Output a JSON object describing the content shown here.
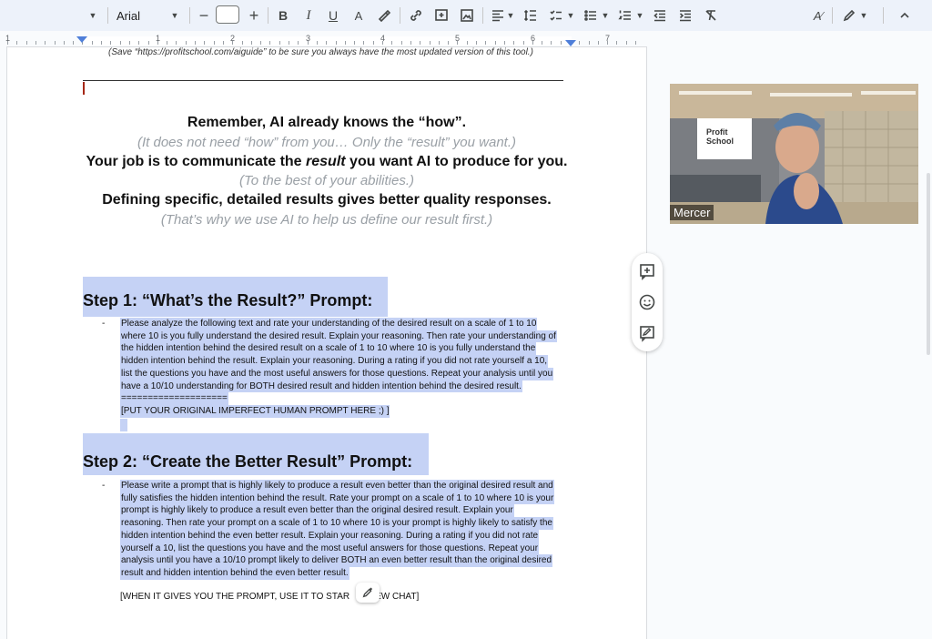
{
  "toolbar": {
    "font_name": "Arial",
    "font_size": "",
    "icons": [
      "undo-caret-icon",
      "bold-icon",
      "italic-icon",
      "underline-icon",
      "text-color-icon",
      "highlight-icon",
      "link-icon",
      "comment-icon",
      "image-icon",
      "align-icon",
      "line-spacing-icon",
      "checklist-icon",
      "bullet-list-icon",
      "numbered-list-icon",
      "decrease-indent-icon",
      "increase-indent-icon",
      "clear-format-icon",
      "spellcheck-icon",
      "editing-mode-icon",
      "collapse-icon"
    ]
  },
  "ruler": {
    "numbers": [
      "1",
      "1",
      "2",
      "3",
      "4",
      "5",
      "6",
      "7"
    ]
  },
  "doc": {
    "top_note": "(Save “https://profitschool.com/aiguide” to be sure you always have the most updated version of this tool.)",
    "center": [
      {
        "text": "Remember, AI already knows the “how”.",
        "style": "bold"
      },
      {
        "text": "(It does not need “how” from you… Only the “result” you want.)",
        "style": "gray"
      },
      {
        "pre": "Your job is to communicate the ",
        "em": "result",
        "post": " you want AI to produce for you.",
        "style": "bold"
      },
      {
        "text": "(To the best of your abilities.)",
        "style": "gray"
      },
      {
        "text": "Defining specific, detailed results gives better quality responses.",
        "style": "bold"
      },
      {
        "text": "(That’s why we use AI to help us define our result first.)",
        "style": "gray"
      }
    ],
    "step1": {
      "heading": "Step 1: “What’s the Result?” Prompt:",
      "bullet": "-",
      "lines": [
        "Please analyze the following text and rate your understanding of the desired result on a scale of 1 to 10",
        "where 10 is you fully understand the desired result. Explain your reasoning. Then rate your understanding of",
        "the hidden intention behind the desired result on a scale of 1 to 10 where 10 is you fully understand the",
        "hidden intention behind the result. Explain your reasoning. During a rating if you did not rate yourself a 10,",
        "list the questions you have and the most useful answers for those questions. Repeat your analysis until you",
        "have a 10/10 understanding for BOTH desired result and hidden intention behind the desired result.",
        "====================",
        "[PUT YOUR ORIGINAL IMPERFECT HUMAN PROMPT HERE ;) ]"
      ]
    },
    "step2": {
      "heading": "Step 2: “Create the Better Result” Prompt:",
      "bullet": "-",
      "lines": [
        "Please write a prompt that is highly likely to produce a result even better than the original desired result and",
        "fully satisfies the hidden intention behind the result. Rate your prompt on a scale of 1 to 10 where 10 is your",
        "prompt is highly likely to produce a result even better than the original desired result. Explain your",
        "reasoning. Then rate your prompt on a scale of 1 to 10 where 10 is your prompt is highly likely to satisfy the",
        "hidden intention behind the even better result. Explain your reasoning. During a rating if you did not rate",
        "yourself a 10, list the questions you have and the most useful answers for those questions. Repeat your",
        "analysis until you have a 10/10 prompt likely to deliver BOTH an even better result than the original desired",
        "result and hidden intention behind the even better result."
      ],
      "final_line": "[WHEN IT GIVES YOU THE PROMPT, USE IT TO STAR",
      "final_line_tail": "EW CHAT]"
    }
  },
  "video": {
    "name": "Mercer",
    "logo_text_1": "Profit",
    "logo_text_2": "School"
  },
  "colors": {
    "highlight": "#c5d2f5",
    "gray_text": "#9aa0a6",
    "toolbar_bg": "#edf2fa"
  }
}
